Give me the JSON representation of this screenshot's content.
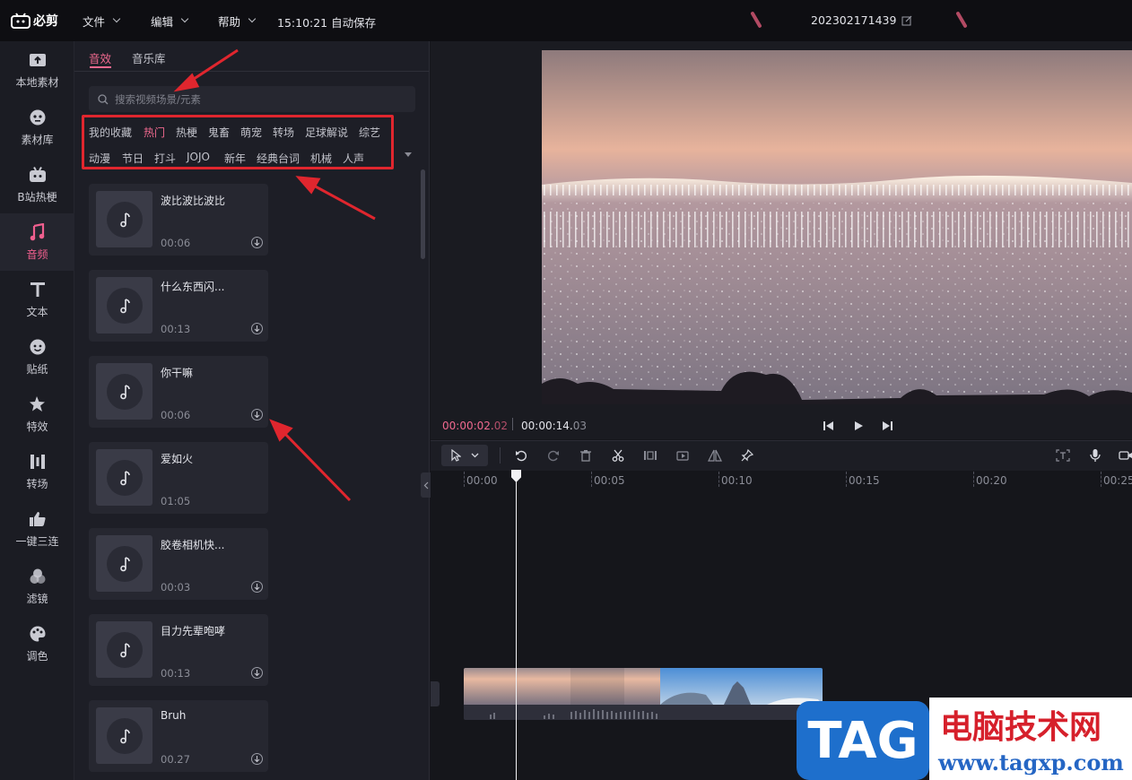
{
  "app": {
    "logo": "必剪",
    "menus": [
      "文件",
      "编辑",
      "帮助"
    ],
    "autosave": "15:10:21 自动保存",
    "project_name": "202302171439"
  },
  "nav": [
    {
      "label": "本地素材",
      "icon": "upload-folder-icon"
    },
    {
      "label": "素材库",
      "icon": "face-icon"
    },
    {
      "label": "B站热梗",
      "icon": "tv-icon"
    },
    {
      "label": "音频",
      "icon": "music-note-icon",
      "active": true
    },
    {
      "label": "文本",
      "icon": "text-t-icon"
    },
    {
      "label": "贴纸",
      "icon": "sticker-icon"
    },
    {
      "label": "特效",
      "icon": "star-effect-icon"
    },
    {
      "label": "转场",
      "icon": "transition-icon"
    },
    {
      "label": "一键三连",
      "icon": "thumbs-up-icon"
    },
    {
      "label": "滤镜",
      "icon": "filter-circles-icon"
    },
    {
      "label": "调色",
      "icon": "palette-icon"
    }
  ],
  "panel": {
    "tabs": [
      "音效",
      "音乐库"
    ],
    "active_tab": 0,
    "search_placeholder": "搜索视频场景/元素",
    "categories_row1": [
      "我的收藏",
      "热门",
      "热梗",
      "鬼畜",
      "萌宠",
      "转场",
      "足球解说",
      "综艺"
    ],
    "categories_row2": [
      "动漫",
      "节日",
      "打斗",
      "JOJO",
      "新年",
      "经典台词",
      "机械",
      "人声"
    ],
    "active_category": "热门",
    "sounds": [
      {
        "title": "波比波比波比",
        "duration": "00:06"
      },
      {
        "title": "什么东西闪...",
        "duration": "00:13"
      },
      {
        "title": "你干嘛",
        "duration": "00:06"
      },
      {
        "title": "爱如火",
        "duration": "01:05"
      },
      {
        "title": "胶卷相机快...",
        "duration": "00:03"
      },
      {
        "title": "目力先辈咆哮",
        "duration": "00:13"
      },
      {
        "title": "Bruh",
        "duration": "00.27"
      }
    ]
  },
  "preview": {
    "current_time_main": "00:00:02.",
    "current_time_frac": "02",
    "total_time_main": "00:00:14.",
    "total_time_frac": "03"
  },
  "timeline": {
    "ticks": [
      "00:00",
      "00:05",
      "00:10",
      "00:15",
      "00:20",
      "00:25"
    ]
  },
  "watermark": {
    "badge": "TAG",
    "site_name": "电脑技术网",
    "url": "www.tagxp.com"
  },
  "colors": {
    "accent": "#f0698f",
    "annotation_red": "#e0262e",
    "background": "#16161c"
  }
}
